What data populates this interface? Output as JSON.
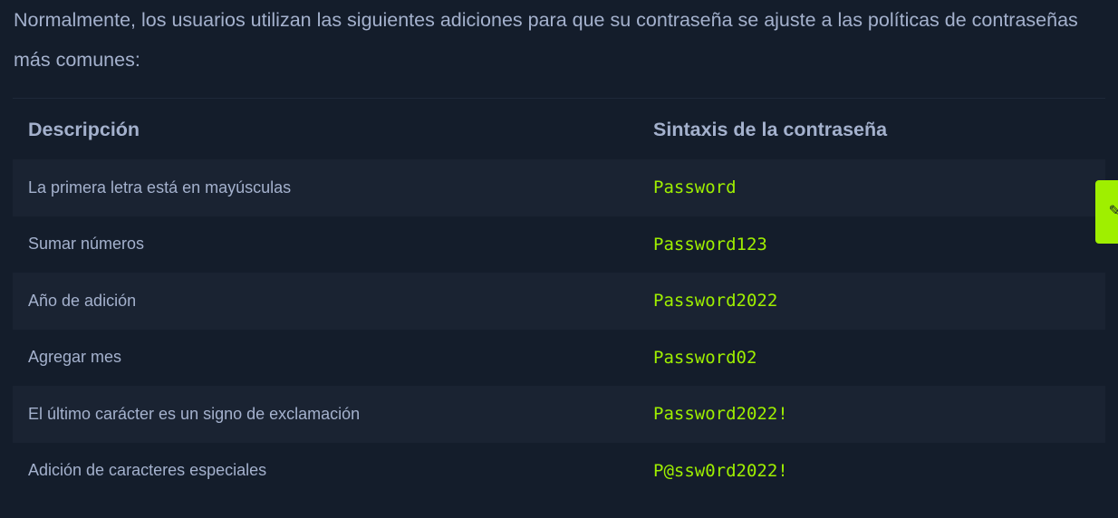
{
  "intro_text": "Normalmente, los usuarios utilizan las siguientes adiciones para que su contraseña se ajuste a las políticas de contraseñas más comunes:",
  "table": {
    "headers": {
      "description": "Descripción",
      "syntax": "Sintaxis de la contraseña"
    },
    "rows": [
      {
        "description": "La primera letra está en mayúsculas",
        "syntax": "Password"
      },
      {
        "description": "Sumar números",
        "syntax": "Password123"
      },
      {
        "description": "Año de adición",
        "syntax": "Password2022"
      },
      {
        "description": "Agregar mes",
        "syntax": "Password02"
      },
      {
        "description": "El último carácter es un signo de exclamación",
        "syntax": "Password2022!"
      },
      {
        "description": "Adición de caracteres especiales",
        "syntax": "P@ssw0rd2022!"
      }
    ]
  },
  "side_tab": {
    "icon": "pencil-icon",
    "icon_glyph": "✎",
    "color": "#9fef00"
  },
  "colors": {
    "background": "#141d2b",
    "text": "#a4b1cd",
    "accent": "#9fef00",
    "row_alt": "#1a2332"
  }
}
